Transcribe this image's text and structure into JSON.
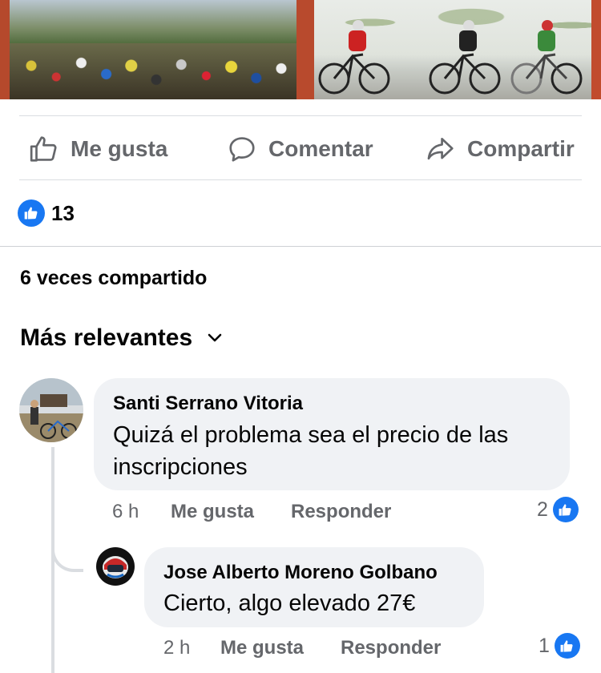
{
  "actions": {
    "like": "Me gusta",
    "comment": "Comentar",
    "share": "Compartir"
  },
  "reactions": {
    "count": "13"
  },
  "shares": {
    "label": "6 veces compartido"
  },
  "sort": {
    "label": "Más relevantes"
  },
  "comments": [
    {
      "author": "Santi Serrano Vitoria",
      "text": "Quizá el problema sea el precio de las inscripciones",
      "time": "6 h",
      "like_label": "Me gusta",
      "reply_label": "Responder",
      "reactions": "2"
    },
    {
      "author": "Jose Alberto Moreno Golbano",
      "text": "Cierto, algo elevado 27€",
      "time": "2 h",
      "like_label": "Me gusta",
      "reply_label": "Responder",
      "reactions": "1"
    }
  ],
  "colors": {
    "accent": "#1877f2",
    "muted": "#65676b",
    "bubble": "#f0f2f5"
  }
}
